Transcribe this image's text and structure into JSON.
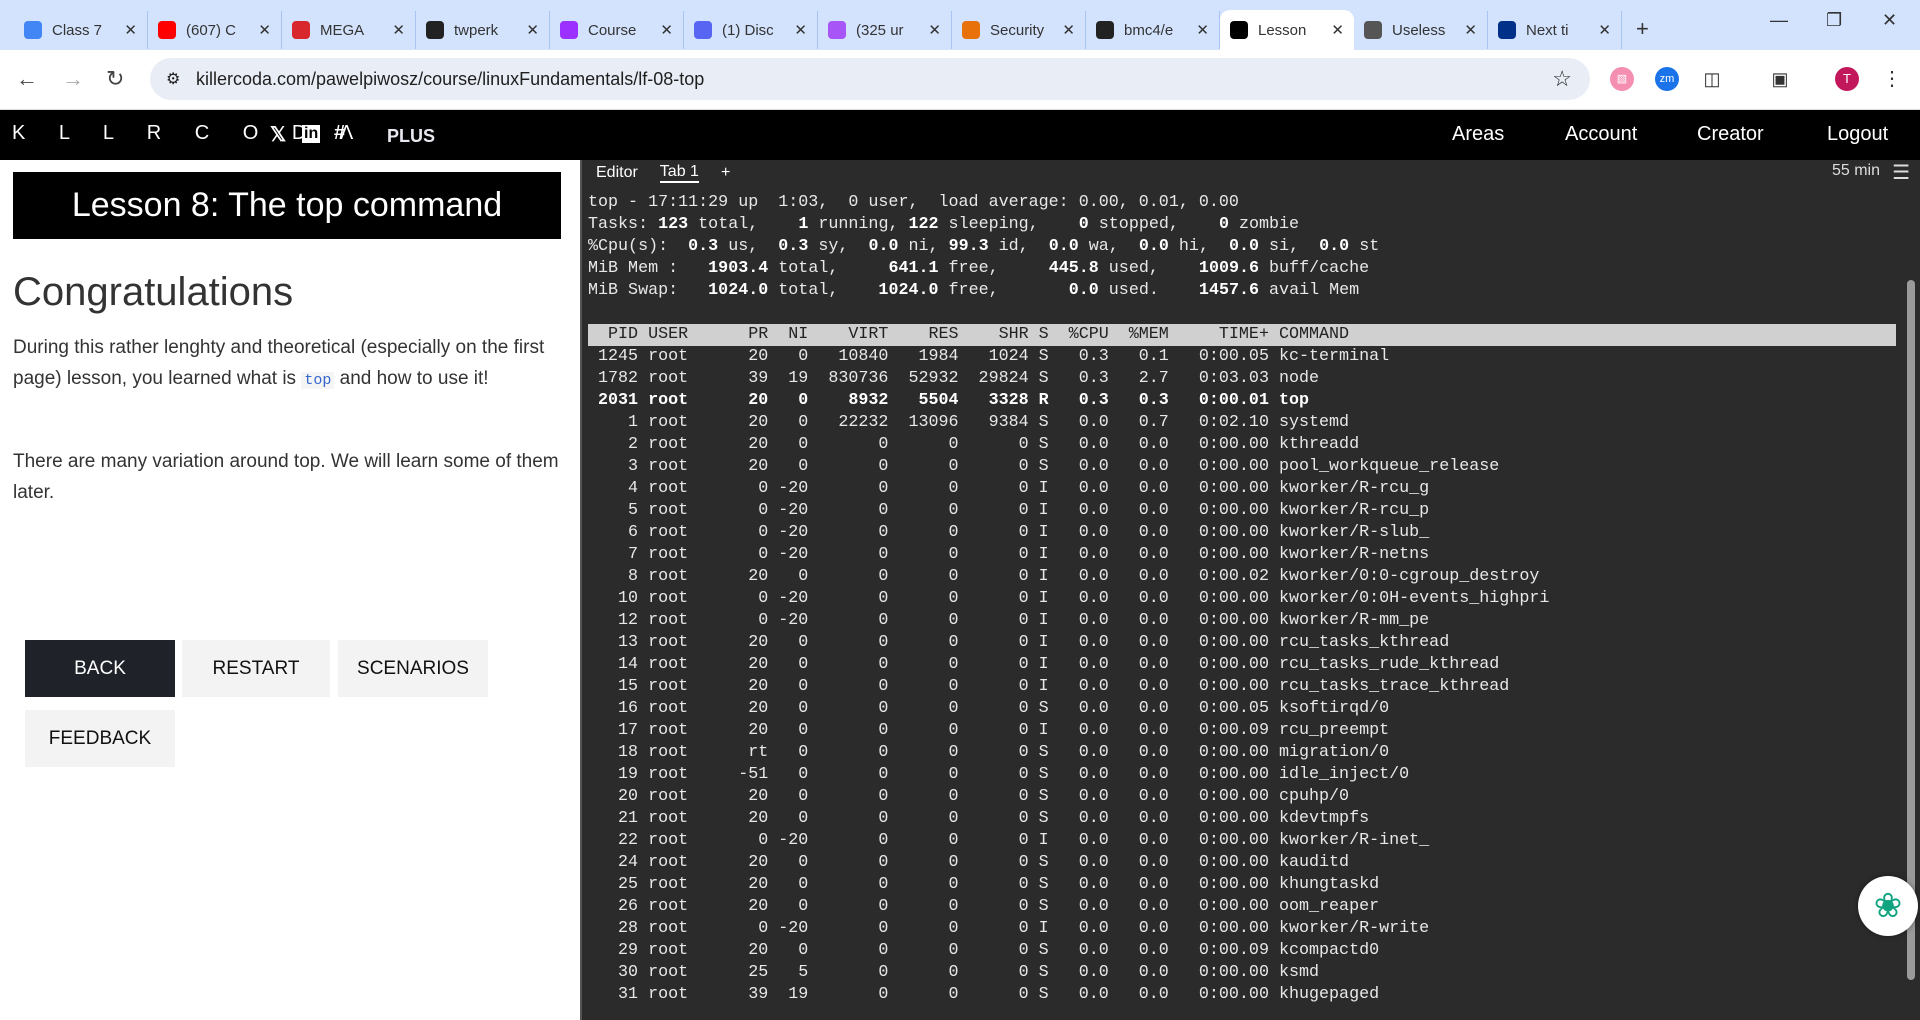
{
  "browser": {
    "tabs": [
      {
        "title": "Class 7",
        "color": "#4285f4",
        "icon": "docs-icon"
      },
      {
        "title": "(607) C",
        "color": "#ff0000",
        "icon": "youtube-icon"
      },
      {
        "title": "MEGA",
        "color": "#d9272e",
        "icon": "mega-icon"
      },
      {
        "title": "twperk",
        "color": "#222",
        "icon": "github-icon"
      },
      {
        "title": "Course",
        "color": "#9b30ff",
        "icon": "course-icon"
      },
      {
        "title": "(1) Disc",
        "color": "#5865f2",
        "icon": "discord-icon"
      },
      {
        "title": "(325 ur",
        "color": "#a855f7",
        "icon": "mail-icon"
      },
      {
        "title": "Security",
        "color": "#e8710a",
        "icon": "security-icon"
      },
      {
        "title": "bmc4/e",
        "color": "#222",
        "icon": "github-icon"
      },
      {
        "title": "Lesson",
        "color": "#000",
        "icon": "killercoda-icon",
        "active": true
      },
      {
        "title": "Useless",
        "color": "#555",
        "icon": "globe-icon"
      },
      {
        "title": "Next ti",
        "color": "#003087",
        "icon": "paypal-icon"
      }
    ],
    "url": "killercoda.com/pawelpiwosz/course/linuxFundamentals/lf-08-top",
    "profile": "T",
    "zm": "zm"
  },
  "site": {
    "logo": "KILLERCODA",
    "plus": "PLUS",
    "nav": [
      "Areas",
      "Account",
      "Creator",
      "Logout"
    ]
  },
  "lesson": {
    "title": "Lesson 8: The top command",
    "heading": "Congratulations",
    "p1_before": "During this rather lenghty and theoretical (especially on the first page) lesson, you learned what is ",
    "p1_code": "top",
    "p1_after": " and how to use it!",
    "p2": "There are many variation around top. We will learn some of them later.",
    "buttons": {
      "back": "BACK",
      "restart": "RESTART",
      "scenarios": "SCENARIOS",
      "feedback": "FEEDBACK"
    }
  },
  "terminal": {
    "tabs": [
      "Editor",
      "Tab 1",
      "+"
    ],
    "timer": "55 min",
    "summary": {
      "line1": "top - 17:11:29 up  1:03,  0 user,  load average: 0.00, 0.01, 0.00",
      "tasks": {
        "total": "123",
        "running": "1",
        "sleeping": "122",
        "stopped": "0",
        "zombie": "0"
      },
      "cpu": {
        "us": "0.3",
        "sy": "0.3",
        "ni": "0.0",
        "id": "99.3",
        "wa": "0.0",
        "hi": "0.0",
        "si": "0.0",
        "st": "0.0"
      },
      "mem": {
        "total": "1903.4",
        "free": "641.1",
        "used": "445.8",
        "buff": "1009.6"
      },
      "swap": {
        "total": "1024.0",
        "free": "1024.0",
        "used": "0.0",
        "avail": "1457.6"
      }
    },
    "columns": [
      "PID",
      "USER",
      "PR",
      "NI",
      "VIRT",
      "RES",
      "SHR",
      "S",
      "%CPU",
      "%MEM",
      "TIME+",
      "COMMAND"
    ],
    "rows": [
      [
        "1245",
        "root",
        "20",
        "0",
        "10840",
        "1984",
        "1024",
        "S",
        "0.3",
        "0.1",
        "0:00.05",
        "kc-terminal"
      ],
      [
        "1782",
        "root",
        "39",
        "19",
        "830736",
        "52932",
        "29824",
        "S",
        "0.3",
        "2.7",
        "0:03.03",
        "node"
      ],
      [
        "2031",
        "root",
        "20",
        "0",
        "8932",
        "5504",
        "3328",
        "R",
        "0.3",
        "0.3",
        "0:00.01",
        "top"
      ],
      [
        "1",
        "root",
        "20",
        "0",
        "22232",
        "13096",
        "9384",
        "S",
        "0.0",
        "0.7",
        "0:02.10",
        "systemd"
      ],
      [
        "2",
        "root",
        "20",
        "0",
        "0",
        "0",
        "0",
        "S",
        "0.0",
        "0.0",
        "0:00.00",
        "kthreadd"
      ],
      [
        "3",
        "root",
        "20",
        "0",
        "0",
        "0",
        "0",
        "S",
        "0.0",
        "0.0",
        "0:00.00",
        "pool_workqueue_release"
      ],
      [
        "4",
        "root",
        "0",
        "-20",
        "0",
        "0",
        "0",
        "I",
        "0.0",
        "0.0",
        "0:00.00",
        "kworker/R-rcu_g"
      ],
      [
        "5",
        "root",
        "0",
        "-20",
        "0",
        "0",
        "0",
        "I",
        "0.0",
        "0.0",
        "0:00.00",
        "kworker/R-rcu_p"
      ],
      [
        "6",
        "root",
        "0",
        "-20",
        "0",
        "0",
        "0",
        "I",
        "0.0",
        "0.0",
        "0:00.00",
        "kworker/R-slub_"
      ],
      [
        "7",
        "root",
        "0",
        "-20",
        "0",
        "0",
        "0",
        "I",
        "0.0",
        "0.0",
        "0:00.00",
        "kworker/R-netns"
      ],
      [
        "8",
        "root",
        "20",
        "0",
        "0",
        "0",
        "0",
        "I",
        "0.0",
        "0.0",
        "0:00.02",
        "kworker/0:0-cgroup_destroy"
      ],
      [
        "10",
        "root",
        "0",
        "-20",
        "0",
        "0",
        "0",
        "I",
        "0.0",
        "0.0",
        "0:00.00",
        "kworker/0:0H-events_highpri"
      ],
      [
        "12",
        "root",
        "0",
        "-20",
        "0",
        "0",
        "0",
        "I",
        "0.0",
        "0.0",
        "0:00.00",
        "kworker/R-mm_pe"
      ],
      [
        "13",
        "root",
        "20",
        "0",
        "0",
        "0",
        "0",
        "I",
        "0.0",
        "0.0",
        "0:00.00",
        "rcu_tasks_kthread"
      ],
      [
        "14",
        "root",
        "20",
        "0",
        "0",
        "0",
        "0",
        "I",
        "0.0",
        "0.0",
        "0:00.00",
        "rcu_tasks_rude_kthread"
      ],
      [
        "15",
        "root",
        "20",
        "0",
        "0",
        "0",
        "0",
        "I",
        "0.0",
        "0.0",
        "0:00.00",
        "rcu_tasks_trace_kthread"
      ],
      [
        "16",
        "root",
        "20",
        "0",
        "0",
        "0",
        "0",
        "S",
        "0.0",
        "0.0",
        "0:00.05",
        "ksoftirqd/0"
      ],
      [
        "17",
        "root",
        "20",
        "0",
        "0",
        "0",
        "0",
        "I",
        "0.0",
        "0.0",
        "0:00.09",
        "rcu_preempt"
      ],
      [
        "18",
        "root",
        "rt",
        "0",
        "0",
        "0",
        "0",
        "S",
        "0.0",
        "0.0",
        "0:00.00",
        "migration/0"
      ],
      [
        "19",
        "root",
        "-51",
        "0",
        "0",
        "0",
        "0",
        "S",
        "0.0",
        "0.0",
        "0:00.00",
        "idle_inject/0"
      ],
      [
        "20",
        "root",
        "20",
        "0",
        "0",
        "0",
        "0",
        "S",
        "0.0",
        "0.0",
        "0:00.00",
        "cpuhp/0"
      ],
      [
        "21",
        "root",
        "20",
        "0",
        "0",
        "0",
        "0",
        "S",
        "0.0",
        "0.0",
        "0:00.00",
        "kdevtmpfs"
      ],
      [
        "22",
        "root",
        "0",
        "-20",
        "0",
        "0",
        "0",
        "I",
        "0.0",
        "0.0",
        "0:00.00",
        "kworker/R-inet_"
      ],
      [
        "24",
        "root",
        "20",
        "0",
        "0",
        "0",
        "0",
        "S",
        "0.0",
        "0.0",
        "0:00.00",
        "kauditd"
      ],
      [
        "25",
        "root",
        "20",
        "0",
        "0",
        "0",
        "0",
        "S",
        "0.0",
        "0.0",
        "0:00.00",
        "khungtaskd"
      ],
      [
        "26",
        "root",
        "20",
        "0",
        "0",
        "0",
        "0",
        "S",
        "0.0",
        "0.0",
        "0:00.00",
        "oom_reaper"
      ],
      [
        "28",
        "root",
        "0",
        "-20",
        "0",
        "0",
        "0",
        "I",
        "0.0",
        "0.0",
        "0:00.00",
        "kworker/R-write"
      ],
      [
        "29",
        "root",
        "20",
        "0",
        "0",
        "0",
        "0",
        "S",
        "0.0",
        "0.0",
        "0:00.09",
        "kcompactd0"
      ],
      [
        "30",
        "root",
        "25",
        "5",
        "0",
        "0",
        "0",
        "S",
        "0.0",
        "0.0",
        "0:00.00",
        "ksmd"
      ],
      [
        "31",
        "root",
        "39",
        "19",
        "0",
        "0",
        "0",
        "S",
        "0.0",
        "0.0",
        "0:00.00",
        "khugepaged"
      ]
    ],
    "bold_pid": "2031"
  }
}
